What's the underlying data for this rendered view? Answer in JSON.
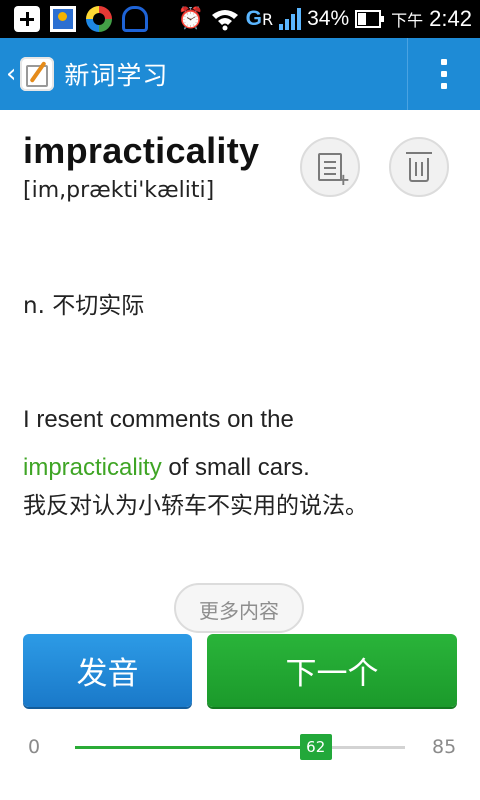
{
  "status_bar": {
    "network": "G",
    "network_sup": "R",
    "battery": "34%",
    "time_prefix": "下午",
    "time": "2:42"
  },
  "app_bar": {
    "back_glyph": "‹",
    "title": "新词学习"
  },
  "word": {
    "text": "impracticality",
    "phonetic": "[im,prækti'kæliti]",
    "meaning": "n. 不切实际",
    "example_before": "I resent comments on the",
    "example_highlight": "impracticality",
    "example_after": " of small cars.",
    "translation": "我反对认为小轿车不实用的说法。"
  },
  "more_button": "更多内容",
  "buttons": {
    "audio": "发音",
    "next": "下一个"
  },
  "progress": {
    "min": "0",
    "max": "85",
    "value": 62
  },
  "colors": {
    "app_bar": "#1e8bd6",
    "highlight": "#3fa525",
    "next_button": "#22a83a",
    "audio_button": "#1e88d9"
  }
}
